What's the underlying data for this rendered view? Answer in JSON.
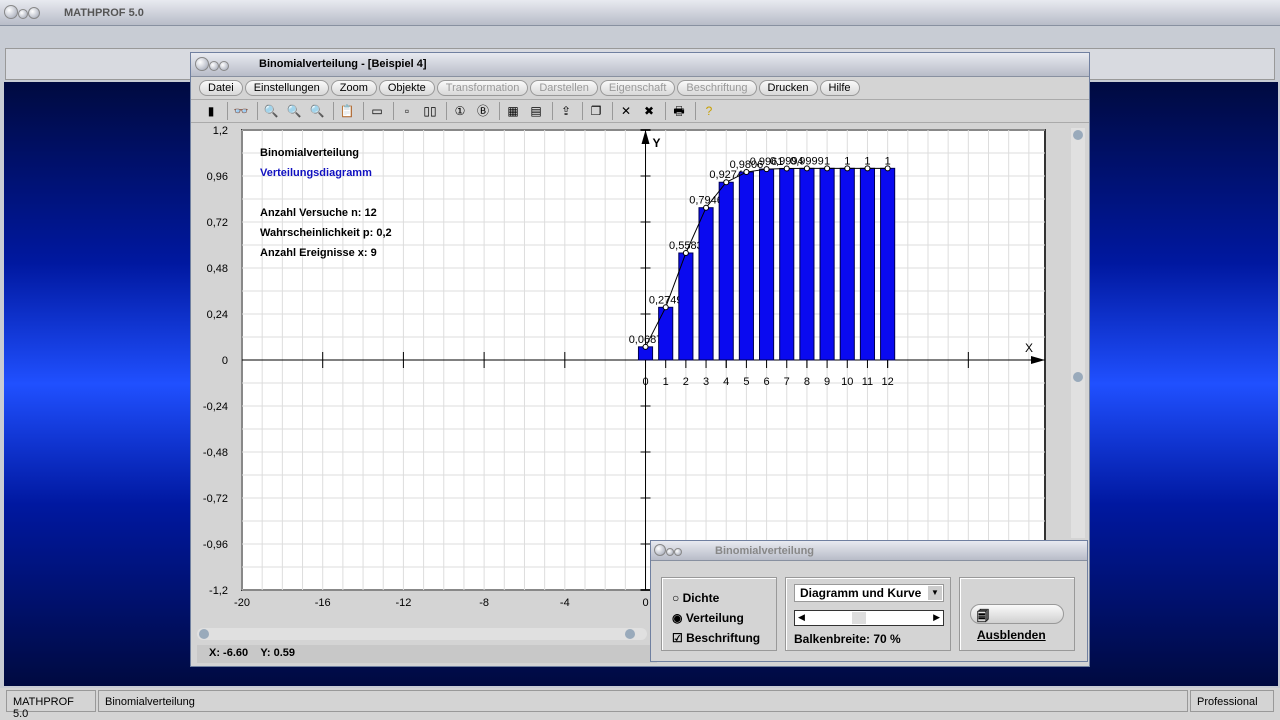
{
  "app": {
    "title": "MATHPROF 5.0"
  },
  "window": {
    "title": "Binomialverteilung - [Beispiel 4]",
    "menu": [
      {
        "label": "Datei",
        "enabled": true
      },
      {
        "label": "Einstellungen",
        "enabled": true
      },
      {
        "label": "Zoom",
        "enabled": true
      },
      {
        "label": "Objekte",
        "enabled": true
      },
      {
        "label": "Transformation",
        "enabled": false
      },
      {
        "label": "Darstellen",
        "enabled": false
      },
      {
        "label": "Eigenschaft",
        "enabled": false
      },
      {
        "label": "Beschriftung",
        "enabled": false
      },
      {
        "label": "Drucken",
        "enabled": true
      },
      {
        "label": "Hilfe",
        "enabled": true
      }
    ],
    "toolbar": [
      "window-icon",
      "glasses-icon",
      "zoom-out-icon",
      "zoom-reset-icon",
      "zoom-in-icon",
      "properties-icon",
      "layout-icon",
      "box-icon",
      "double-box-icon",
      "circle-1-icon",
      "circle-b-icon",
      "table-icon",
      "calc-icon",
      "export-icon",
      "copy-icon",
      "cross-icon",
      "double-cross-icon",
      "print-icon",
      "help-icon"
    ]
  },
  "info": {
    "line1": "Binomialverteilung",
    "line2": "Verteilungsdiagramm",
    "line3": "Anzahl Versuche n: 12",
    "line4": "Wahrscheinlichkeit p: 0,2",
    "line5": "Anzahl Ereignisse x: 9",
    "accent": "#1010c0"
  },
  "chart_data": {
    "type": "bar",
    "xlabel": "X",
    "ylabel": "Y",
    "xlim": [
      -20,
      19.8
    ],
    "ylim": [
      -1.2,
      1.2
    ],
    "grid": true,
    "bar_color": "#0a0af0",
    "x": [
      0,
      1,
      2,
      3,
      4,
      5,
      6,
      7,
      8,
      9,
      10,
      11,
      12
    ],
    "values": [
      0.0687,
      0.2749,
      0.5583,
      0.7946,
      0.9274,
      0.9806,
      0.9961,
      0.9994,
      0.9999,
      1,
      1,
      1,
      1
    ],
    "labels": [
      "0,0687",
      "0,2749",
      "0,5583",
      "0,7946",
      "0,9274",
      "0,9806",
      "0,9961",
      "0,9994",
      "0,9999",
      "1",
      "1",
      "1",
      "1"
    ],
    "yticks": [
      "1,2",
      "0,96",
      "0,72",
      "0,48",
      "0,24",
      "0",
      "-0,24",
      "-0,48",
      "-0,72",
      "-0,96",
      "-1,2"
    ],
    "ytick_values": [
      1.2,
      0.96,
      0.72,
      0.48,
      0.24,
      0,
      -0.24,
      -0.48,
      -0.72,
      -0.96,
      -1.2
    ],
    "xticks": [
      "-20",
      "-16",
      "-12",
      "-8",
      "-4",
      "0"
    ],
    "xtick_values": [
      -20,
      -16,
      -12,
      -8,
      -4,
      0
    ],
    "xcat_labels": [
      "0",
      "1",
      "2",
      "3",
      "4",
      "5",
      "6",
      "7",
      "8",
      "9",
      "10",
      "11",
      "12"
    ]
  },
  "coords": {
    "x": "X: -6.60",
    "y": "Y: 0.59"
  },
  "dialog": {
    "title": "Binomialverteilung",
    "radio_dichte": "Dichte",
    "radio_verteilung": "Verteilung",
    "selected": "Verteilung",
    "check_label": "Beschriftung",
    "checked": true,
    "select_value": "Diagramm und Kurve",
    "slider_label": "Balkenbreite:  70 %",
    "slider_value": 70,
    "hide_button": "Ausblenden"
  },
  "statusbar": {
    "app": "MATHPROF 5.0",
    "module": "Binomialverteilung",
    "edition": "Professional"
  }
}
